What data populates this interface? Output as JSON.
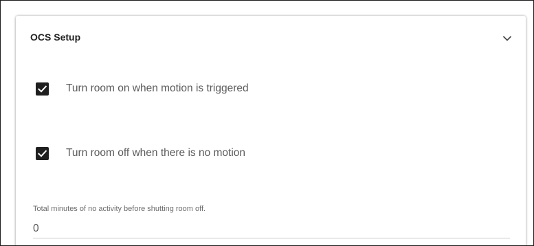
{
  "panel": {
    "title": "OCS Setup",
    "expand_icon": "chevron-down-icon"
  },
  "options": [
    {
      "label": "Turn room on when motion is triggered",
      "checked": true,
      "icon": "checkmark-icon"
    },
    {
      "label": "Turn room off when there is no motion",
      "checked": true,
      "icon": "checkmark-icon"
    }
  ],
  "timeout_field": {
    "label": "Total minutes of no activity before shutting room off.",
    "value": "0"
  },
  "colors": {
    "checkbox_fill": "#1f1f1f",
    "checkmark": "#ffffff",
    "text": "#5a5a5a"
  }
}
